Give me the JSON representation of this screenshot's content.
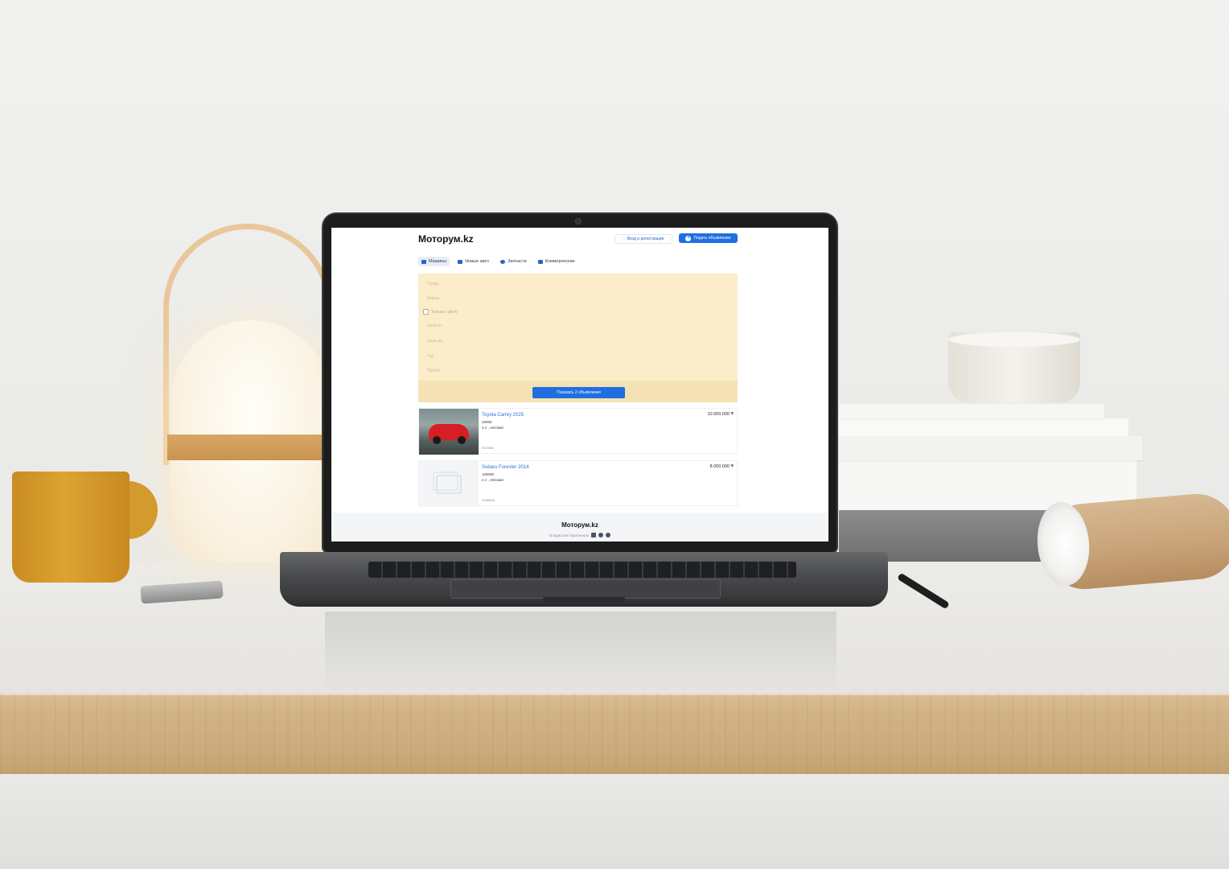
{
  "site": {
    "logo": "Моторум.kz",
    "login_label": "Вход и регистрация",
    "post_label": "Подать объявление"
  },
  "tabs": [
    {
      "label": "Машины",
      "active": true,
      "icon": "car-icon"
    },
    {
      "label": "Новые авто",
      "active": false,
      "icon": "car-icon"
    },
    {
      "label": "Запчасти",
      "active": false,
      "icon": "gear-icon"
    },
    {
      "label": "Коммерческие",
      "active": false,
      "icon": "truck-icon"
    }
  ],
  "filters": {
    "fields": [
      "Город",
      "Марка",
      "Цена от",
      "Цена до",
      "Год",
      "Пробег"
    ],
    "only_photo_label": "Только с фото",
    "show_button": "Показать 2 объявления"
  },
  "listings": [
    {
      "title": "Toyota Camry 2025",
      "mileage": "10000",
      "specs": "2 л , Автомат",
      "city": "Астана",
      "price": "10.000.000 ₸",
      "has_photo": true
    },
    {
      "title": "Subaru Forester 2014",
      "mileage": "125000",
      "specs": "2 л , Автомат",
      "city": "Алматы",
      "price": "8.000.000 ₸",
      "has_photo": false
    }
  ],
  "footer": {
    "logo": "Моторум.kz",
    "author": "Владислав Паратенков"
  },
  "colors": {
    "accent": "#1f6fe0",
    "filter_bg": "#fbecca",
    "link": "#2b6fd6"
  }
}
